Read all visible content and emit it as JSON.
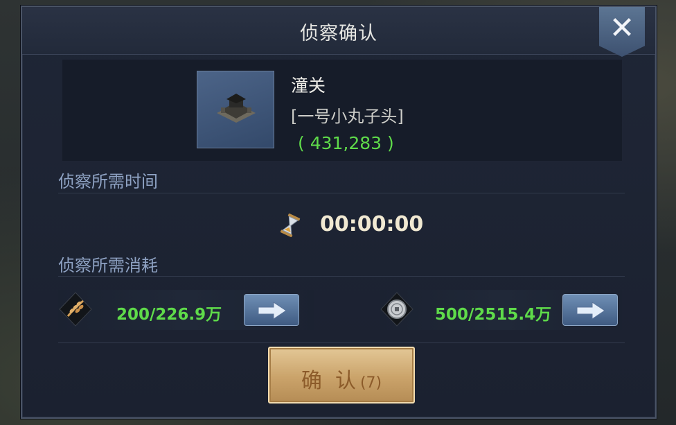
{
  "dialog": {
    "title": "侦察确认",
    "close_icon": "close-icon"
  },
  "target": {
    "name": "潼关",
    "owner": "[一号小丸子头]",
    "coordinates": "( 431,283 )",
    "thumbnail_icon": "fortress-icon"
  },
  "time_section": {
    "label": "侦察所需时间",
    "duration": "00:00:00",
    "icon": "hourglass-icon"
  },
  "cost_section": {
    "label": "侦察所需消耗",
    "resources": [
      {
        "icon": "grain-icon",
        "amount": "200/226.9万"
      },
      {
        "icon": "silver-coin-icon",
        "amount": "500/2515.4万"
      }
    ]
  },
  "confirm_button": {
    "label": "确  认",
    "count": "(7)"
  },
  "colors": {
    "accent_green": "#5fdb4a",
    "section_label": "#8fa3c4",
    "confirm_gold": "#caa36a",
    "dialog_bg": "#1f2636"
  }
}
